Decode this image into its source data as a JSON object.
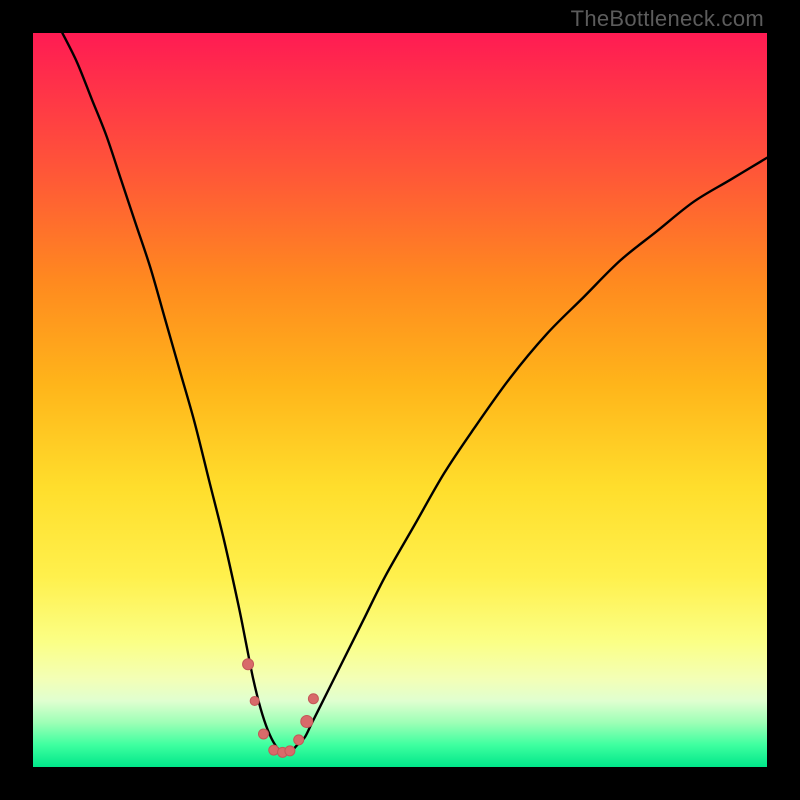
{
  "watermark": "TheBottleneck.com",
  "colors": {
    "background": "#000000",
    "curve_stroke": "#000000",
    "marker_fill": "#d86a6a",
    "marker_stroke": "#c45858"
  },
  "chart_data": {
    "type": "line",
    "title": "",
    "xlabel": "",
    "ylabel": "",
    "xlim": [
      0,
      100
    ],
    "ylim": [
      0,
      100
    ],
    "grid": false,
    "legend": false,
    "description": "Bottleneck curve: y-axis represents bottleneck percentage (top = 100%, bottom = 0%); x-axis represents relative component performance ratio. Minimum near x≈33 indicates balanced configuration.",
    "series": [
      {
        "name": "bottleneck-curve",
        "x": [
          4,
          6,
          8,
          10,
          12,
          14,
          16,
          18,
          20,
          22,
          24,
          26,
          28,
          29,
          30,
          31,
          32,
          33,
          34,
          35,
          36,
          37,
          38,
          40,
          42,
          45,
          48,
          52,
          56,
          60,
          65,
          70,
          75,
          80,
          85,
          90,
          95,
          100
        ],
        "y": [
          100,
          96,
          91,
          86,
          80,
          74,
          68,
          61,
          54,
          47,
          39,
          31,
          22,
          17,
          12,
          8,
          5,
          3,
          2,
          2,
          3,
          4,
          6,
          10,
          14,
          20,
          26,
          33,
          40,
          46,
          53,
          59,
          64,
          69,
          73,
          77,
          80,
          83
        ]
      }
    ],
    "markers": {
      "name": "highlight-points",
      "x": [
        29.3,
        30.2,
        31.4,
        32.8,
        34.0,
        35.0,
        36.2,
        37.3,
        38.2
      ],
      "y": [
        14.0,
        9.0,
        4.5,
        2.3,
        2.0,
        2.2,
        3.7,
        6.2,
        9.3
      ],
      "size": [
        11,
        9,
        10,
        10,
        10,
        10,
        10,
        12,
        10
      ]
    },
    "gradient_stops": [
      {
        "pct": 0,
        "color": "#ff1b53"
      },
      {
        "pct": 8,
        "color": "#ff3448"
      },
      {
        "pct": 20,
        "color": "#ff5a36"
      },
      {
        "pct": 34,
        "color": "#ff8a1f"
      },
      {
        "pct": 48,
        "color": "#ffb51a"
      },
      {
        "pct": 62,
        "color": "#ffde2c"
      },
      {
        "pct": 74,
        "color": "#fff04c"
      },
      {
        "pct": 83,
        "color": "#fbff86"
      },
      {
        "pct": 88,
        "color": "#f3ffb6"
      },
      {
        "pct": 91,
        "color": "#e0ffd0"
      },
      {
        "pct": 94,
        "color": "#9cffb6"
      },
      {
        "pct": 97,
        "color": "#3effa0"
      },
      {
        "pct": 100,
        "color": "#00e78a"
      }
    ]
  }
}
